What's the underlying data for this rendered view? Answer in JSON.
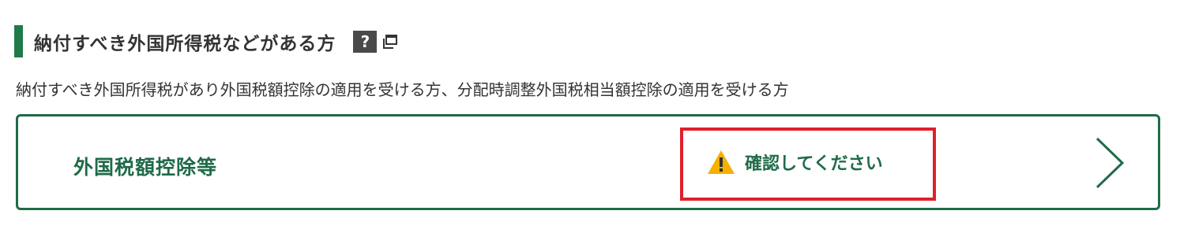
{
  "section": {
    "title": "納付すべき外国所得税などがある方",
    "help_icon": "?",
    "description": "納付すべき外国所得税があり外国税額控除の適用を受ける方、分配時調整外国税相当額控除の適用を受ける方"
  },
  "card": {
    "title": "外国税額控除等",
    "status_text": "確認してください",
    "status_icon": "warning-icon",
    "arrow_icon": "chevron-right-icon"
  },
  "colors": {
    "accent_green": "#1f6b48",
    "header_bar_green": "#1f7a48",
    "highlight_red": "#e0202a",
    "warning_yellow": "#f5b000",
    "help_icon_bg": "#4a4a4a"
  }
}
